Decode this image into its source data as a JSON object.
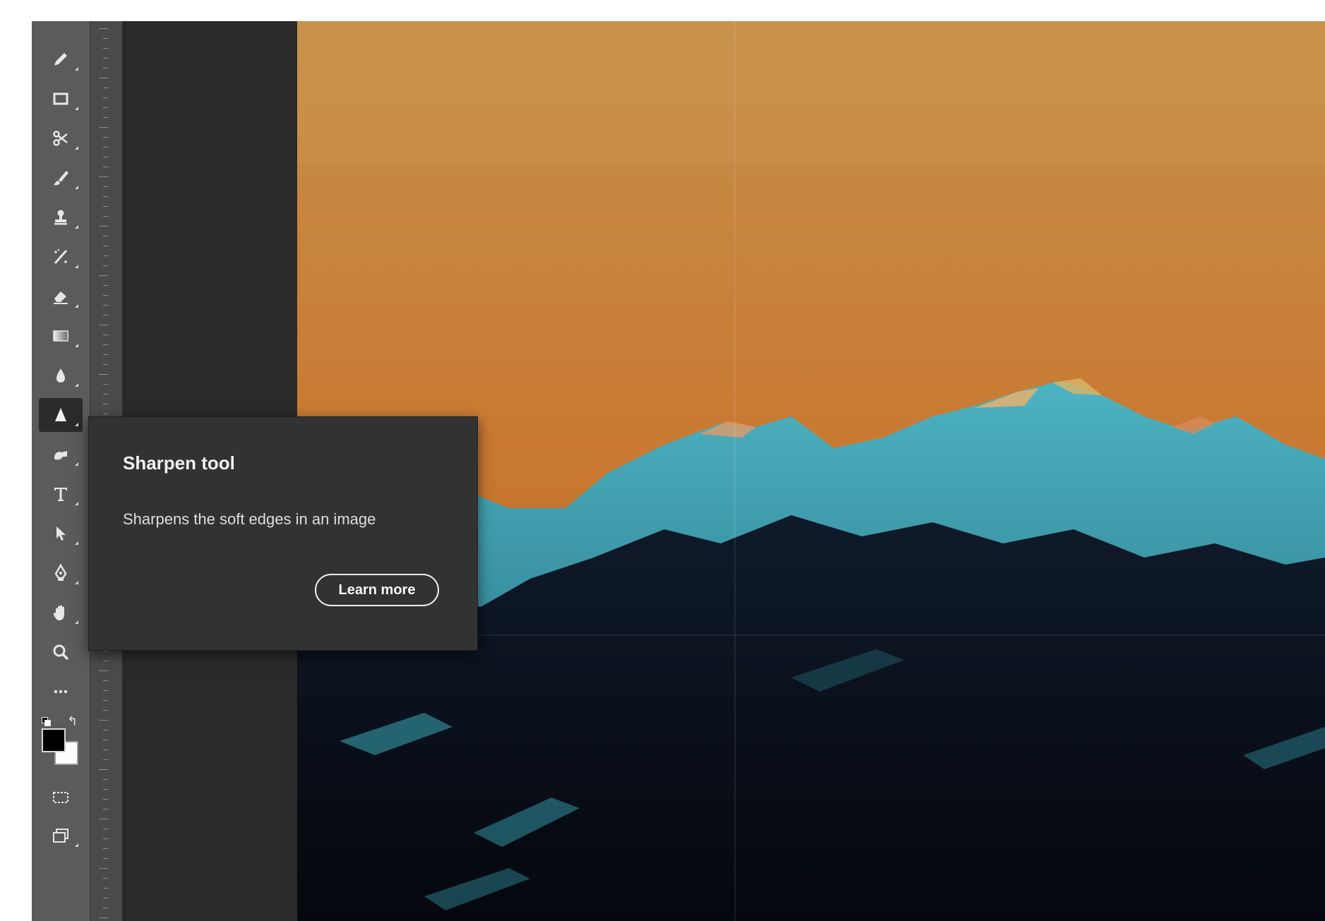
{
  "toolbar": {
    "tools": [
      {
        "name": "pencil-icon"
      },
      {
        "name": "marquee-icon"
      },
      {
        "name": "crop-icon"
      },
      {
        "name": "brush-icon"
      },
      {
        "name": "clone-stamp-icon"
      },
      {
        "name": "healing-brush-icon"
      },
      {
        "name": "eraser-icon"
      },
      {
        "name": "gradient-icon"
      },
      {
        "name": "blur-icon"
      },
      {
        "name": "sharpen-icon",
        "active": true
      },
      {
        "name": "smudge-icon"
      },
      {
        "name": "type-icon"
      },
      {
        "name": "path-selection-icon"
      },
      {
        "name": "pen-icon"
      },
      {
        "name": "hand-icon"
      },
      {
        "name": "zoom-icon"
      },
      {
        "name": "more-tools-icon"
      }
    ],
    "foreground_color": "#000000",
    "background_color": "#ffffff",
    "mode_icons": [
      "quick-mask-icon",
      "screen-mode-icon"
    ]
  },
  "tooltip": {
    "title": "Sharpen tool",
    "description": "Sharpens the soft edges in an image",
    "button_label": "Learn more"
  },
  "colors": {
    "toolbar_bg": "#5b5b5b",
    "tooltip_bg": "#323232",
    "sky_top": "#c68f4a",
    "sky_bottom": "#c86a24",
    "mountain_cyan": "#3fa8b8",
    "mountain_dark": "#0b1120"
  }
}
